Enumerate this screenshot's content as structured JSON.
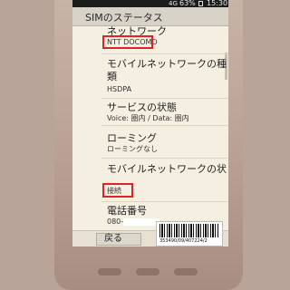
{
  "status_bar": {
    "signal": "4G",
    "battery": "63%",
    "time": "15:30"
  },
  "title_bar": {
    "title": "SIMのステータス"
  },
  "items": [
    {
      "title": "ネットワーク",
      "value": "NTT DOCOMO"
    },
    {
      "title_line1": "モバイルネットワークの種",
      "title_line2": "類",
      "value": "HSDPA"
    },
    {
      "title": "サービスの状態",
      "value": "Voice: 圏内 / Data: 圏内"
    },
    {
      "title": "ローミング",
      "value": "ローミングなし"
    },
    {
      "title": "モバイルネットワークの状",
      "value": "接続"
    },
    {
      "title": "電話番号",
      "value": "080-"
    }
  ],
  "back_button": {
    "label": "戻る"
  },
  "barcode_label": {
    "code": "353490/09/407224/2"
  },
  "colors": {
    "highlight": "#e0232b",
    "screen_bg": "#f4efe1",
    "status_bar_bg": "#1c1c1c"
  }
}
